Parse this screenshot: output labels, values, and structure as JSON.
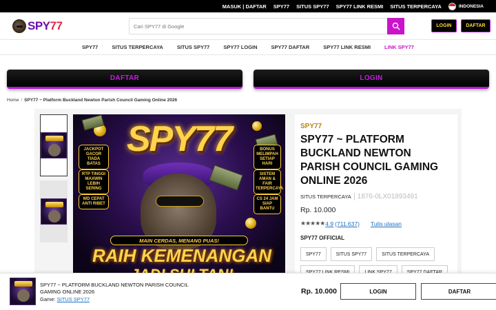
{
  "topbar": {
    "links": [
      "MASUK | DAFTAR",
      "SPY77",
      "SITUS SPY77",
      "SPY77 LINK RESMI",
      "SITUS TERPERCAYA"
    ],
    "language": "INDONESIA"
  },
  "header": {
    "logo_text": "SPY",
    "logo_num": "77",
    "search_placeholder": "Cari SPY77 di Google",
    "login_label": "LOGIN",
    "register_label": "DAFTAR"
  },
  "nav": {
    "items": [
      "SPY77",
      "SITUS TERPERCAYA",
      "SITUS SPY77",
      "SPY77 LOGIN",
      "SPY77 DAFTAR",
      "SPY77 LINK RESMI",
      "LINK SPY77"
    ]
  },
  "cta": {
    "daftar": "DAFTAR",
    "login": "LOGIN"
  },
  "breadcrumb": {
    "home": "Home",
    "separator": "/",
    "current": "SPY77 ~ Platform Buckland Newton Parish Council Gaming Online 2026"
  },
  "hero_art": {
    "logo": "SPY77",
    "badges_left": [
      "JACKPOT GACOR TIADA BATAS",
      "RTP TINGGI MAXWIN LEBIH SERING",
      "WD CEPAT ANTI RIBET"
    ],
    "badges_right": [
      "BONUS MELIMPAH SETIAP HARI",
      "SISTEM AMAN & FAIR TERPERCAYA",
      "CS 24 JAM SIAP BANTU"
    ],
    "ribbon": "MAIN CERDAS, MENANG PUAS!",
    "headline": "RAIH KEMENANGAN",
    "headline2": "JADI SULTAN!"
  },
  "product": {
    "brand": "SPY77",
    "title": "SPY77 ~ PLATFORM BUCKLAND NEWTON PARISH COUNCIL GAMING ONLINE 2026",
    "category": "SITUS TERPERCAYA",
    "sku": "1876-0LX01893491",
    "price": "Rp. 10.000",
    "stars": "★★★★★",
    "rating_value": "4.9",
    "review_count": "(711.637)",
    "write_review": "Tulis ulasan",
    "official_label": "SPY77 OFFICIAL",
    "chips": [
      "SPY77",
      "SITUS SPY77",
      "SITUS TERPERCAYA",
      "SPY77 LINK RESMI",
      "LINK SPY77",
      "SPY77 DAFTAR"
    ]
  },
  "sticky": {
    "title": "SPY77 ~ PLATFORM BUCKLAND NEWTON PARISH COUNCIL GAMING ONLINE 2026",
    "game_label": "Game:",
    "game_link": "SITUS SPY77",
    "price": "Rp. 10.000",
    "login": "LOGIN",
    "register": "DAFTAR"
  },
  "colors": {
    "accent_magenta": "#c914c9",
    "button_border_purple": "#b519d9",
    "gold": "#b8860b",
    "link_blue": "#1a6fc2"
  }
}
